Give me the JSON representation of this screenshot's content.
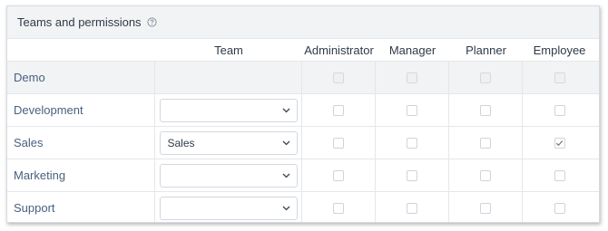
{
  "section": {
    "title": "Teams and permissions",
    "help_icon": "question-circle-icon"
  },
  "columns": {
    "team": "Team",
    "administrator": "Administrator",
    "manager": "Manager",
    "planner": "Planner",
    "employee": "Employee"
  },
  "rows": [
    {
      "label": "Demo",
      "team_value": "",
      "has_select": false,
      "disabled": true,
      "administrator": false,
      "manager": false,
      "planner": false,
      "employee": false
    },
    {
      "label": "Development",
      "team_value": "",
      "has_select": true,
      "disabled": false,
      "administrator": false,
      "manager": false,
      "planner": false,
      "employee": false
    },
    {
      "label": "Sales",
      "team_value": "Sales",
      "has_select": true,
      "disabled": false,
      "administrator": false,
      "manager": false,
      "planner": false,
      "employee": true
    },
    {
      "label": "Marketing",
      "team_value": "",
      "has_select": true,
      "disabled": false,
      "administrator": false,
      "manager": false,
      "planner": false,
      "employee": false
    },
    {
      "label": "Support",
      "team_value": "",
      "has_select": true,
      "disabled": false,
      "administrator": false,
      "manager": false,
      "planner": false,
      "employee": false
    }
  ],
  "icons": {
    "dropdown": "chevron-down-icon",
    "check": "checkmark-icon"
  },
  "colors": {
    "header_bg": "#f2f3f5",
    "label_text": "#48617f",
    "checkbox_border": "#cfd4da"
  }
}
